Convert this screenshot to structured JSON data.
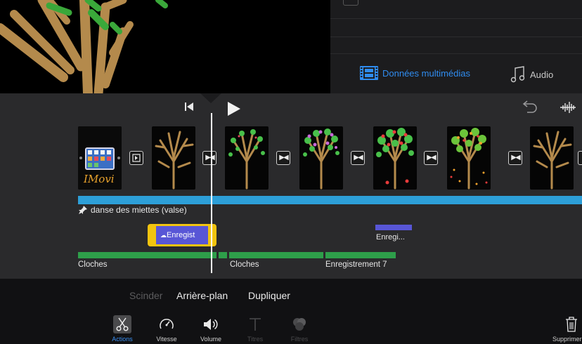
{
  "library": {
    "tabs": [
      {
        "label": "Données multimédias",
        "icon": "media-filmstrip-icon",
        "active": true
      },
      {
        "label": "Audio",
        "icon": "music-note-icon",
        "active": false
      }
    ]
  },
  "timeline": {
    "controls": [
      "skip-to-start-icon",
      "play-icon",
      "undo-icon",
      "audio-waveform-icon"
    ],
    "video_clips": [
      {
        "thumbnail": "imovie-app-screenshot",
        "overlay_text": "IMovi"
      },
      {
        "thumbnail": "bare-tree-drawing"
      },
      {
        "thumbnail": "tree-with-green-leaves"
      },
      {
        "thumbnail": "tree-with-purple-blossoms"
      },
      {
        "thumbnail": "tree-with-red-fruit"
      },
      {
        "thumbnail": "tree-with-autumn-leaves"
      },
      {
        "thumbnail": "bare-tree-drawing"
      }
    ],
    "music_track": {
      "label": "danse des miettes (valse)",
      "color": "#2d9fd8"
    },
    "recordings": [
      {
        "label": "Enregist",
        "selected": true,
        "color": "#5856d6",
        "highlight": "#f2c40f"
      },
      {
        "label": "Enregi...",
        "selected": false,
        "color": "#5856d6"
      }
    ],
    "sound_effects": [
      {
        "label": "Cloches"
      },
      {
        "label": "Cloches"
      },
      {
        "label": "Enregistrement 7"
      }
    ],
    "sfx_color": "#2e9e4a"
  },
  "toolbar": {
    "actions": {
      "split": "Scinder",
      "background": "Arrière-plan",
      "duplicate": "Dupliquer"
    },
    "tools": [
      {
        "label": "Actions",
        "icon": "scissors-icon",
        "active": true
      },
      {
        "label": "Vitesse",
        "icon": "speedometer-icon"
      },
      {
        "label": "Volume",
        "icon": "speaker-icon"
      },
      {
        "label": "Titres",
        "icon": "text-titles-icon",
        "disabled": true
      },
      {
        "label": "Filtres",
        "icon": "filters-circles-icon",
        "disabled": true
      }
    ],
    "delete_label": "Supprimer",
    "accent": "#3a8ff0"
  }
}
